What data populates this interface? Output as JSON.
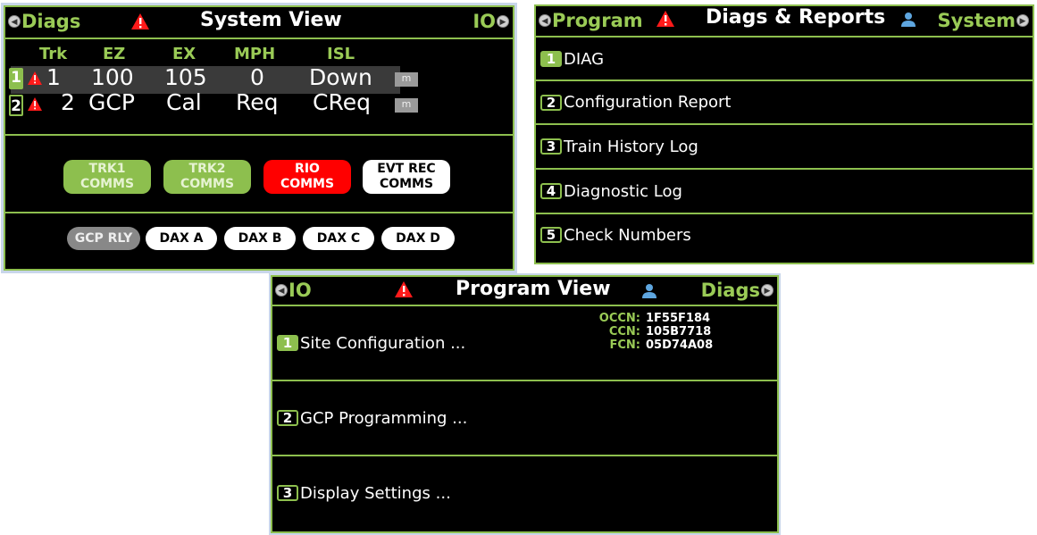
{
  "system_view": {
    "title": "System View",
    "left_nav": "Diags",
    "right_nav": "IO",
    "headers": [
      "Trk",
      "EZ",
      "EX",
      "MPH",
      "ISL"
    ],
    "rows": [
      {
        "num": "1",
        "trk": "1",
        "ez": "100",
        "ex": "105",
        "mph": "0",
        "isl": "Down",
        "badge": "m"
      },
      {
        "num": "2",
        "trk": "2",
        "ez": "GCP",
        "ex": "Cal",
        "mph": "Req",
        "isl": "CReq",
        "badge": "m"
      }
    ],
    "comms": [
      {
        "line1": "TRK1",
        "line2": "COMMS",
        "color": "green"
      },
      {
        "line1": "TRK2",
        "line2": "COMMS",
        "color": "green"
      },
      {
        "line1": "RIO",
        "line2": "COMMS",
        "color": "red"
      },
      {
        "line1": "EVT REC",
        "line2": "COMMS",
        "color": "white"
      }
    ],
    "relays": [
      "GCP RLY",
      "DAX A",
      "DAX B",
      "DAX C",
      "DAX D"
    ]
  },
  "diags_reports": {
    "title": "Diags & Reports",
    "left_nav": "Program",
    "right_nav": "System",
    "items": [
      {
        "num": "1",
        "label": "DIAG"
      },
      {
        "num": "2",
        "label": "Configuration Report"
      },
      {
        "num": "3",
        "label": "Train History Log"
      },
      {
        "num": "4",
        "label": "Diagnostic Log"
      },
      {
        "num": "5",
        "label": "Check Numbers"
      }
    ]
  },
  "program_view": {
    "title": "Program View",
    "left_nav": "IO",
    "right_nav": "Diags",
    "check_numbers": [
      {
        "key": "OCCN:",
        "value": "1F55F184"
      },
      {
        "key": "CCN:",
        "value": "105B7718"
      },
      {
        "key": "FCN:",
        "value": "05D74A08"
      }
    ],
    "items": [
      {
        "num": "1",
        "label": "Site Configuration ..."
      },
      {
        "num": "2",
        "label": "GCP Programming ..."
      },
      {
        "num": "3",
        "label": "Display Settings ..."
      }
    ]
  },
  "colors": {
    "accent_green": "#8dbf4e",
    "alarm_red": "#ff0000",
    "background": "#000000"
  }
}
